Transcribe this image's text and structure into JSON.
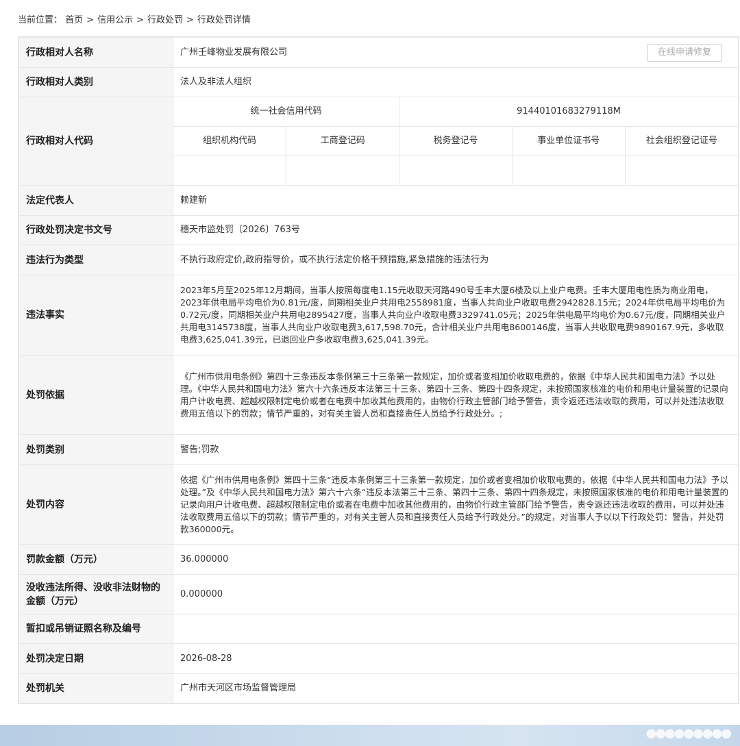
{
  "breadcrumb": {
    "prefix": "当前位置：",
    "items": [
      "首页",
      "信用公示",
      "行政处罚",
      "行政处罚详情"
    ],
    "separator": ">"
  },
  "apply_button": "在线申请修复",
  "codes": {
    "credit_code_label": "统一社会信用代码",
    "credit_code_value": "91440101683279118M",
    "sub_headers": [
      "组织机构代码",
      "工商登记码",
      "税务登记号",
      "事业单位证书号",
      "社会组织登记证号"
    ],
    "sub_values": [
      "",
      "",
      "",
      "",
      ""
    ]
  },
  "rows": [
    {
      "label": "行政相对人名称",
      "value": "广州壬峰物业发展有限公司"
    },
    {
      "label": "行政相对人类别",
      "value": "法人及非法人组织"
    },
    {
      "label": "行政相对人代码",
      "value": ""
    },
    {
      "label": "法定代表人",
      "value": "赖建新"
    },
    {
      "label": "行政处罚决定书文号",
      "value": "穗天市监处罚〔2026〕763号"
    },
    {
      "label": "违法行为类型",
      "value": "不执行政府定价,政府指导价，或不执行法定价格干预措施,紧急措施的违法行为"
    },
    {
      "label": "违法事实",
      "value": "2023年5月至2025年12月期间，当事人按照每度电1.15元收取天河路490号壬丰大厦6楼及以上业户电费。壬丰大厦用电性质为商业用电，2023年供电局平均电价为0.81元/度，同期相关业户共用电2558981度，当事人共向业户收取电费2942828.15元；2024年供电局平均电价为0.72元/度，同期相关业户共用电2895427度，当事人共向业户收取电费3329741.05元；2025年供电局平均电价为0.67元/度，同期相关业户共用电3145738度，当事人共向业户收取电费3,617,598.70元，合计相关业户共用电8600146度，当事人共收取电费9890167.9元，多收取电费3,625,041.39元，已退回业户多收取电费3,625,041.39元。"
    },
    {
      "label": "处罚依据",
      "value": "《广州市供用电条例》第四十三条违反本条例第三十三条第一款规定，加价或者变相加价收取电费的，依据《中华人民共和国电力法》予以处理。《中华人民共和国电力法》第六十六条违反本法第三十三条、第四十三条、第四十四条规定，未按照国家核准的电价和用电计量装置的记录向用户计收电费、超越权限制定电价或者在电费中加收其他费用的，由物价行政主管部门给予警告，责令返还违法收取的费用，可以并处违法收取费用五倍以下的罚款；情节严重的，对有关主管人员和直接责任人员给予行政处分。;"
    },
    {
      "label": "处罚类别",
      "value": "警告;罚款"
    },
    {
      "label": "处罚内容",
      "value": "依据《广州市供用电条例》第四十三条“违反本条例第三十三条第一款规定，加价或者变相加价收取电费的，依据《中华人民共和国电力法》予以处理。”及《中华人民共和国电力法》第六十六条“违反本法第三十三条、第四十三条、第四十四条规定，未按照国家核准的电价和用电计量装置的记录向用户计收电费、超越权限制定电价或者在电费中加收其他费用的，由物价行政主管部门给予警告，责令返还违法收取的费用，可以并处违法收取费用五倍以下的罚款；情节严重的，对有关主管人员和直接责任人员给予行政处分。”的规定，对当事人予以以下行政处罚：警告，并处罚款360000元。"
    },
    {
      "label": "罚款金额（万元）",
      "value": "36.000000"
    },
    {
      "label": "没收违法所得、没收非法财物的金额（万元）",
      "value": "0.000000"
    },
    {
      "label": "暂扣或吊销证照名称及编号",
      "value": ""
    },
    {
      "label": "处罚决定日期",
      "value": "2026-08-28"
    },
    {
      "label": "处罚机关",
      "value": "广州市天河区市场监督管理局"
    }
  ]
}
